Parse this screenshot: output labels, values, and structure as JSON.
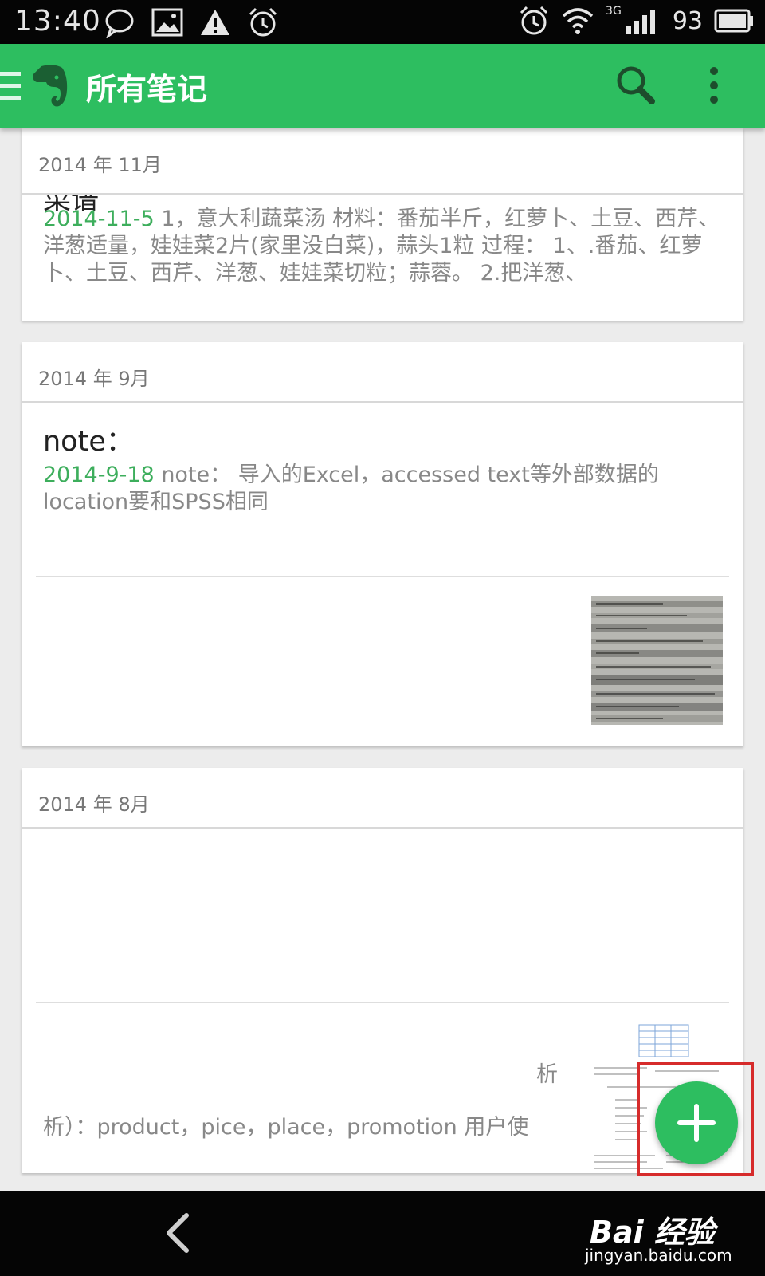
{
  "status_bar": {
    "time": "13:40",
    "network_tag": "3G",
    "battery": "93",
    "icons_left": [
      "chat-bubble-icon",
      "image-icon",
      "warning-icon",
      "alarm-icon"
    ],
    "icons_right": [
      "alarm-icon",
      "wifi-icon",
      "signal-icon",
      "battery-icon"
    ]
  },
  "app_bar": {
    "title": "所有笔记",
    "color": "#2dbe60"
  },
  "sections": [
    {
      "header": "2014 年 11月",
      "notes": [
        {
          "title": "菜谱",
          "date": "2014-11-5",
          "snippet": " 1，意大利蔬菜汤 材料：番茄半斤，红萝卜、土豆、西芹、洋葱适量，娃娃菜2片(家里没白菜)，蒜头1粒 过程： 1、.番茄、红萝卜、土豆、西芹、洋葱、娃娃菜切粒；蒜蓉。 2.把洋葱、"
        }
      ]
    },
    {
      "header": "2014 年 9月",
      "notes": [
        {
          "title": "note：",
          "date": "2014-9-18",
          "snippet": " note： 导入的Excel，accessed text等外部数据的location要和SPSS相同"
        }
      ]
    },
    {
      "header": "2014 年 8月",
      "notes": [
        {
          "title": "",
          "date": "",
          "snippet_line1": "析",
          "snippet_line2": "析）：product，pice，place，promotion 用户使"
        }
      ]
    }
  ],
  "fab": {
    "label": "+",
    "highlight_color": "#d62b2b"
  },
  "watermark": {
    "main": "Bai 经验",
    "sub": "jingyan.baidu.com"
  }
}
